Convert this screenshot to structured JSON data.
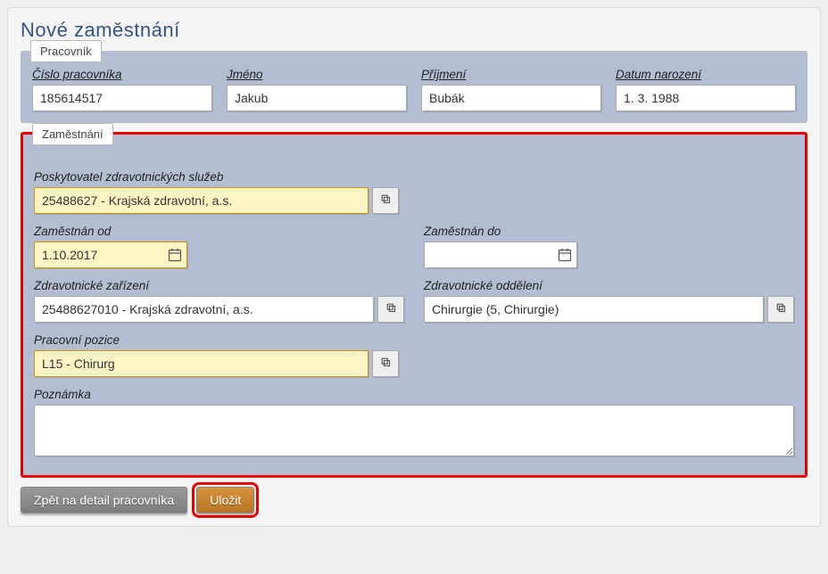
{
  "title": "Nové zaměstnání",
  "fieldset_worker": {
    "legend": "Pracovník",
    "id_label": "Číslo pracovníka",
    "id_value": "185614517",
    "firstname_label": "Jméno",
    "firstname_value": "Jakub",
    "lastname_label": "Příjmení",
    "lastname_value": "Bubák",
    "dob_label": "Datum narození",
    "dob_value": "1. 3. 1988"
  },
  "fieldset_job": {
    "legend": "Zaměstnání",
    "provider_label": "Poskytovatel zdravotnických služeb",
    "provider_value": "25488627 - Krajská zdravotní, a.s.",
    "from_label": "Zaměstnán od",
    "from_value": "1.10.2017",
    "to_label": "Zaměstnán do",
    "to_value": "",
    "facility_label": "Zdravotnické zařízení",
    "facility_value": "25488627010 - Krajská zdravotní, a.s.",
    "department_label": "Zdravotnické oddělení",
    "department_value": "Chirurgie (5, Chirurgie)",
    "position_label": "Pracovní pozice",
    "position_value": "L15 - Chirurg",
    "note_label": "Poznámka",
    "note_value": ""
  },
  "buttons": {
    "back": "Zpět na detail pracovníka",
    "save": "Uložit"
  }
}
